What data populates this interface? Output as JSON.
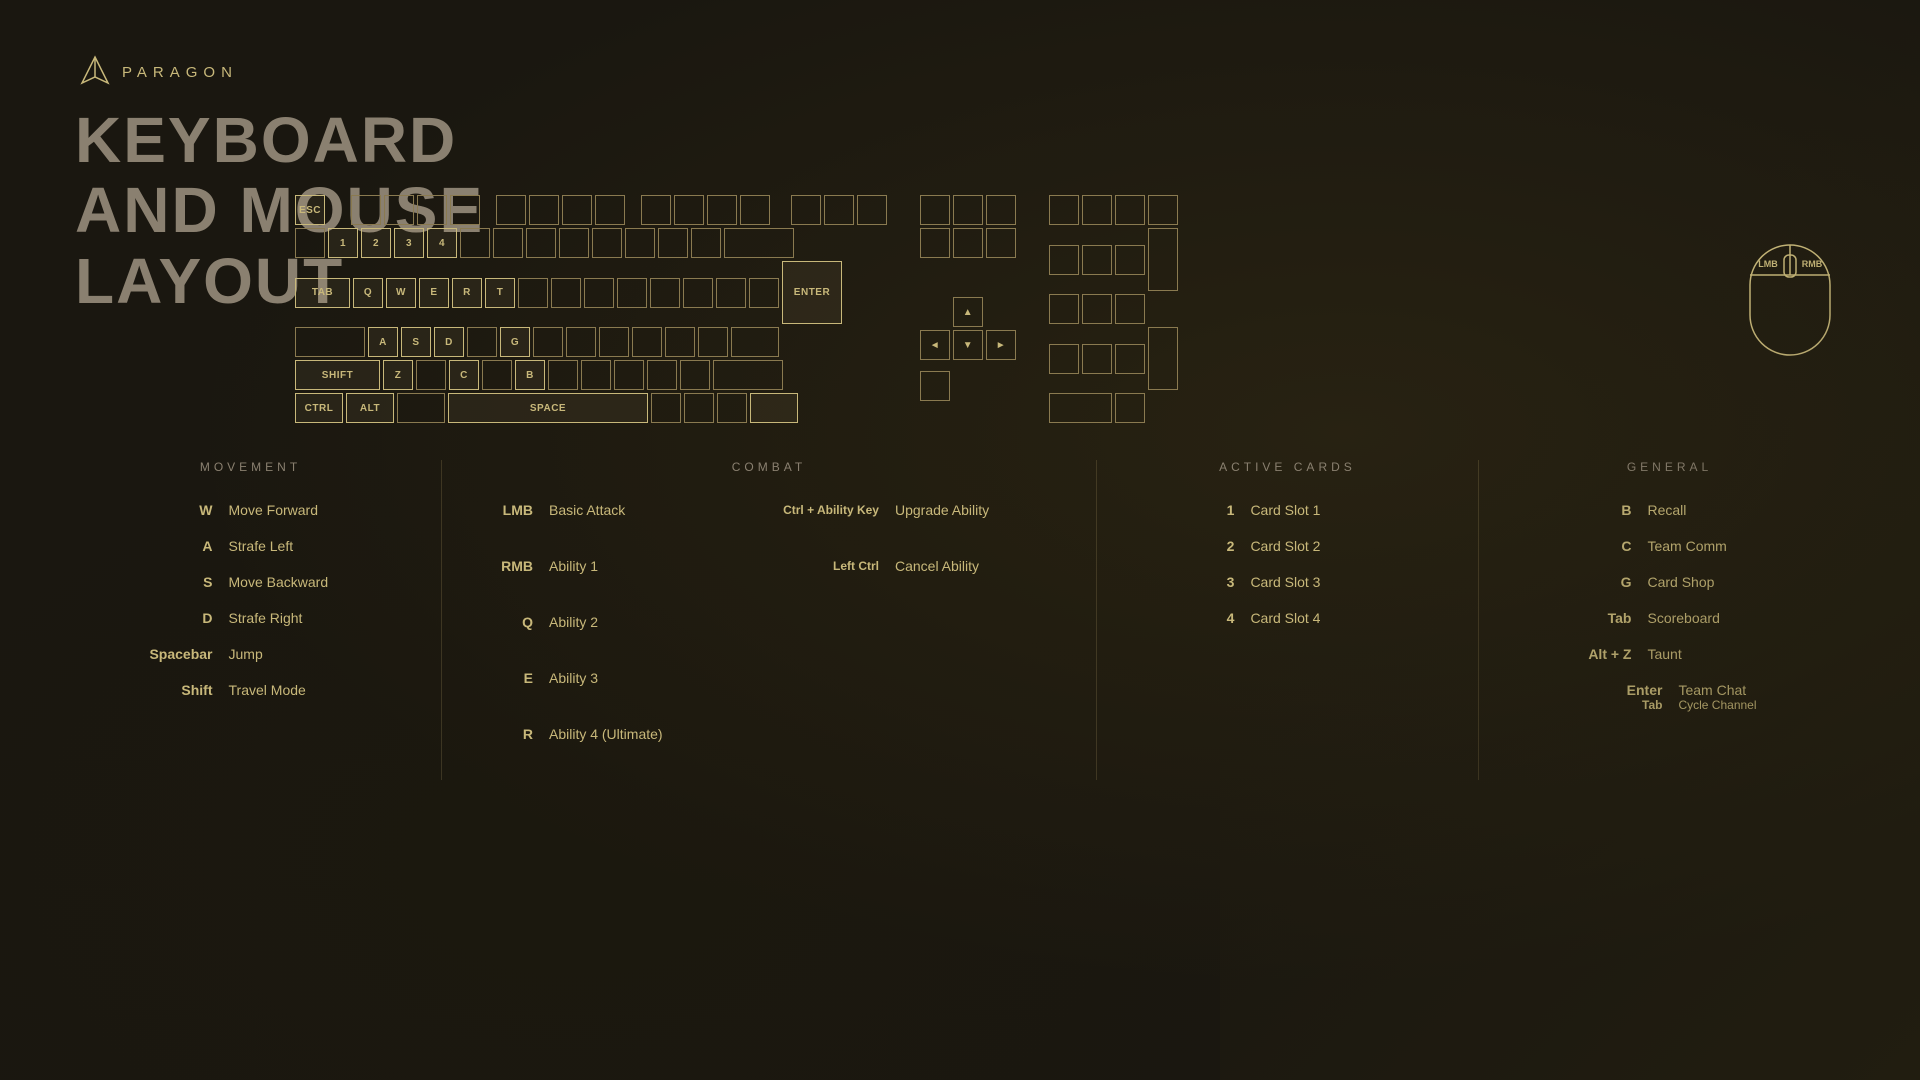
{
  "logo": {
    "text": "PARAGON"
  },
  "title": {
    "line1": "KEYBOARD",
    "line2": "AND MOUSE",
    "line3": "LAYOUT"
  },
  "sections": {
    "movement": {
      "label": "MOVEMENT",
      "bindings": [
        {
          "key": "W",
          "action": "Move Forward"
        },
        {
          "key": "A",
          "action": "Strafe Left"
        },
        {
          "key": "S",
          "action": "Move Backward"
        },
        {
          "key": "D",
          "action": "Strafe Right"
        },
        {
          "key": "Spacebar",
          "action": "Jump"
        },
        {
          "key": "Shift",
          "action": "Travel Mode"
        }
      ]
    },
    "combat": {
      "label": "COMBAT",
      "col1": [
        {
          "key": "LMB",
          "action": "Basic Attack"
        },
        {
          "key": "RMB",
          "action": "Ability 1"
        },
        {
          "key": "Q",
          "action": "Ability 2"
        },
        {
          "key": "E",
          "action": "Ability 3"
        },
        {
          "key": "R",
          "action": "Ability 4 (Ultimate)"
        }
      ],
      "col2": [
        {
          "key": "Ctrl + Ability Key",
          "action": "Upgrade Ability"
        },
        {
          "key": "Left Ctrl",
          "action": "Cancel Ability"
        }
      ]
    },
    "active_cards": {
      "label": "ACTIVE CARDS",
      "bindings": [
        {
          "key": "1",
          "action": "Card Slot 1"
        },
        {
          "key": "2",
          "action": "Card Slot 2"
        },
        {
          "key": "3",
          "action": "Card Slot 3"
        },
        {
          "key": "4",
          "action": "Card Slot 4"
        }
      ]
    },
    "general": {
      "label": "GENERAL",
      "bindings": [
        {
          "key": "B",
          "action": "Recall"
        },
        {
          "key": "C",
          "action": "Team Comm"
        },
        {
          "key": "G",
          "action": "Card Shop"
        },
        {
          "key": "Tab",
          "action": "Scoreboard"
        },
        {
          "key": "Alt + Z",
          "action": "Taunt"
        },
        {
          "key_main": "Enter",
          "action_main": "Team Chat",
          "key_sub": "Tab",
          "action_sub": "Cycle Channel",
          "type": "double"
        }
      ]
    }
  }
}
